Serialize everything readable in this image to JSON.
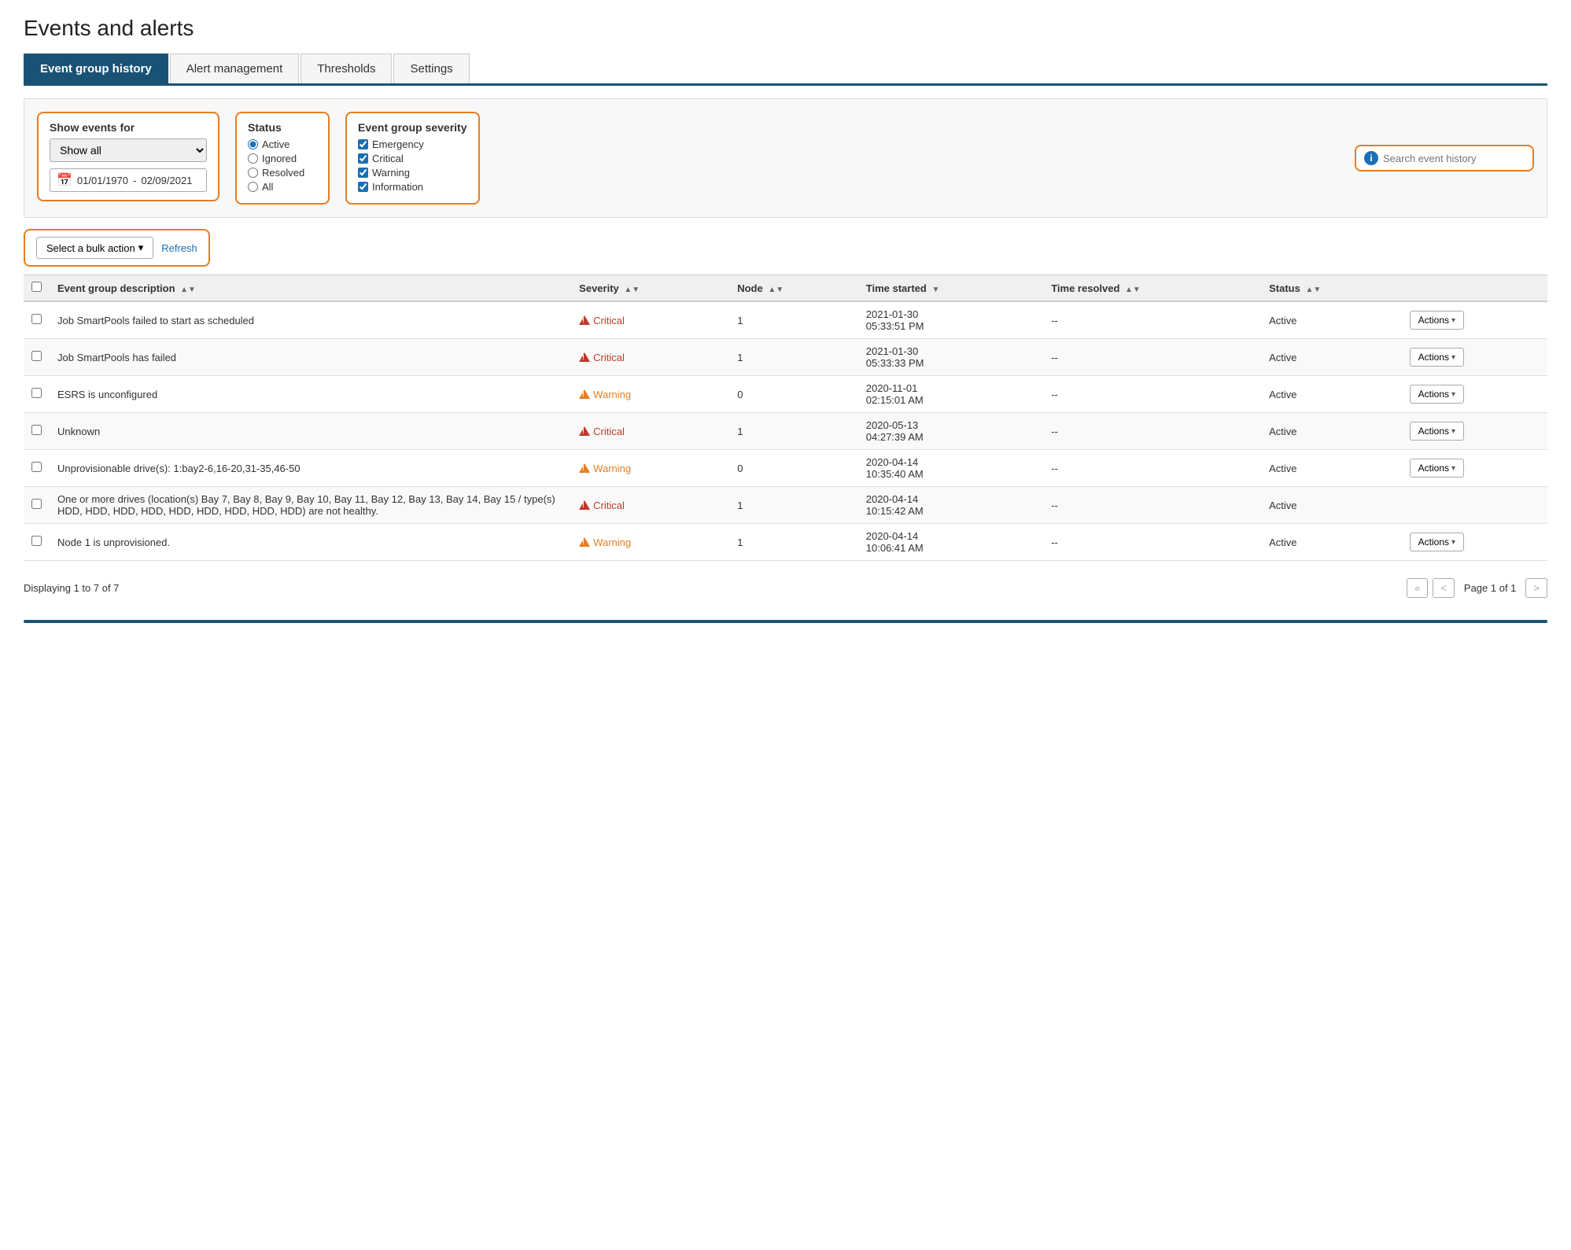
{
  "page": {
    "title": "Events and alerts"
  },
  "tabs": [
    {
      "id": "event-group-history",
      "label": "Event group history",
      "active": true
    },
    {
      "id": "alert-management",
      "label": "Alert management",
      "active": false
    },
    {
      "id": "thresholds",
      "label": "Thresholds",
      "active": false
    },
    {
      "id": "settings",
      "label": "Settings",
      "active": false
    }
  ],
  "filters": {
    "show_events_for_label": "Show events for",
    "show_all_option": "Show all",
    "date_from": "01/01/1970",
    "date_to": "02/09/2021",
    "status_label": "Status",
    "status_options": [
      {
        "value": "active",
        "label": "Active",
        "checked": true
      },
      {
        "value": "ignored",
        "label": "Ignored",
        "checked": false
      },
      {
        "value": "resolved",
        "label": "Resolved",
        "checked": false
      },
      {
        "value": "all",
        "label": "All",
        "checked": false
      }
    ],
    "severity_label": "Event group severity",
    "severity_options": [
      {
        "value": "emergency",
        "label": "Emergency",
        "checked": true
      },
      {
        "value": "critical",
        "label": "Critical",
        "checked": true
      },
      {
        "value": "warning",
        "label": "Warning",
        "checked": true
      },
      {
        "value": "information",
        "label": "Information",
        "checked": true
      }
    ],
    "search_placeholder": "Search event history"
  },
  "toolbar": {
    "bulk_action_label": "Select a bulk action",
    "refresh_label": "Refresh"
  },
  "table": {
    "columns": [
      {
        "id": "description",
        "label": "Event group description"
      },
      {
        "id": "severity",
        "label": "Severity"
      },
      {
        "id": "node",
        "label": "Node"
      },
      {
        "id": "time_started",
        "label": "Time started"
      },
      {
        "id": "time_resolved",
        "label": "Time resolved"
      },
      {
        "id": "status",
        "label": "Status"
      },
      {
        "id": "actions",
        "label": ""
      }
    ],
    "rows": [
      {
        "description": "Job SmartPools failed to start as scheduled",
        "severity": "Critical",
        "severity_type": "critical",
        "node": "1",
        "time_started": "2021-01-30\n05:33:51 PM",
        "time_resolved": "--",
        "status": "Active",
        "show_actions": true
      },
      {
        "description": "Job SmartPools has failed",
        "severity": "Critical",
        "severity_type": "critical",
        "node": "1",
        "time_started": "2021-01-30\n05:33:33 PM",
        "time_resolved": "--",
        "status": "Active",
        "show_actions": true
      },
      {
        "description": "ESRS is unconfigured",
        "severity": "Warning",
        "severity_type": "warning",
        "node": "0",
        "time_started": "2020-11-01\n02:15:01 AM",
        "time_resolved": "--",
        "status": "Active",
        "show_actions": true
      },
      {
        "description": "Unknown",
        "severity": "Critical",
        "severity_type": "critical",
        "node": "1",
        "time_started": "2020-05-13\n04:27:39 AM",
        "time_resolved": "--",
        "status": "Active",
        "show_actions": true
      },
      {
        "description": "Unprovisionable drive(s): 1:bay2-6,16-20,31-35,46-50",
        "severity": "Warning",
        "severity_type": "warning",
        "node": "0",
        "time_started": "2020-04-14\n10:35:40 AM",
        "time_resolved": "--",
        "status": "Active",
        "show_actions": true
      },
      {
        "description": "One or more drives (location(s) Bay 7, Bay 8, Bay 9, Bay 10, Bay 11, Bay 12, Bay 13, Bay 14, Bay 15 / type(s) HDD, HDD, HDD, HDD, HDD, HDD, HDD, HDD, HDD) are not healthy.",
        "severity": "Critical",
        "severity_type": "critical",
        "node": "1",
        "time_started": "2020-04-14\n10:15:42 AM",
        "time_resolved": "--",
        "status": "Active",
        "show_actions": false
      },
      {
        "description": "Node 1 is unprovisioned.",
        "severity": "Warning",
        "severity_type": "warning",
        "node": "1",
        "time_started": "2020-04-14\n10:06:41 AM",
        "time_resolved": "--",
        "status": "Active",
        "show_actions": true
      }
    ]
  },
  "pagination": {
    "display_text": "Displaying 1 to 7 of 7",
    "page_label": "Page 1 of 1",
    "first_btn": "«",
    "prev_btn": "<",
    "next_btn": ">"
  },
  "actions_label": "Actions"
}
